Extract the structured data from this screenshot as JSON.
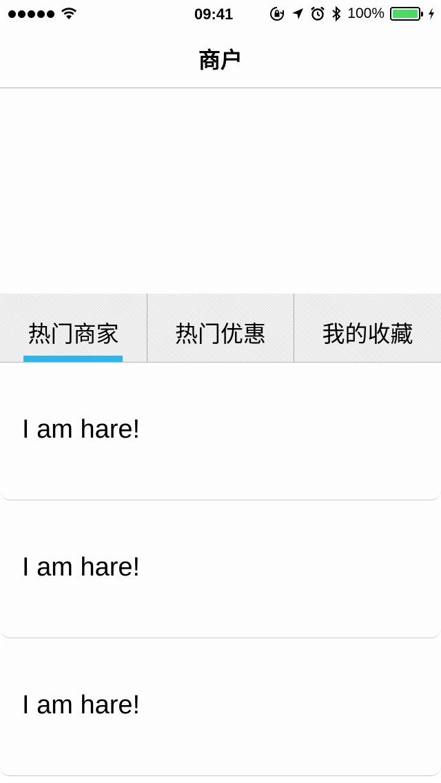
{
  "status_bar": {
    "time": "09:41",
    "battery_percent": "100%",
    "battery_level": 1.0,
    "battery_color": "#4cd964"
  },
  "nav": {
    "title": "商户"
  },
  "tabs": [
    {
      "label": "热门商家",
      "selected": true
    },
    {
      "label": "热门优惠",
      "selected": false
    },
    {
      "label": "我的收藏",
      "selected": false
    }
  ],
  "indicator_color": "#34b4e4",
  "list": {
    "items": [
      {
        "text": "I am hare!"
      },
      {
        "text": "I am hare!"
      },
      {
        "text": "I am hare!"
      }
    ]
  },
  "icons": [
    "signal-icon",
    "wifi-icon",
    "orientation-lock-icon",
    "location-icon",
    "alarm-icon",
    "bluetooth-icon",
    "battery-icon",
    "charging-icon"
  ]
}
